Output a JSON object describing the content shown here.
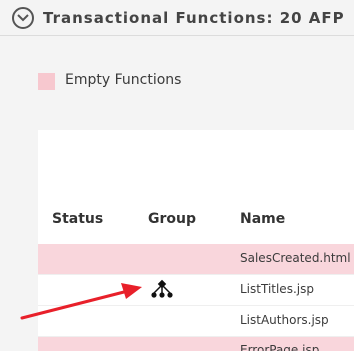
{
  "section": {
    "title": "Transactional Functions: 20 AFP"
  },
  "legend": {
    "label": "Empty Functions",
    "swatch_color": "#f7c8cf"
  },
  "table": {
    "columns": [
      "Status",
      "Group",
      "Name"
    ],
    "rows": [
      {
        "name": "SalesCreated.html",
        "empty": true,
        "group_icon": ""
      },
      {
        "name": "ListTitles.jsp",
        "empty": false,
        "group_icon": "group-hierarchy-icon"
      },
      {
        "name": "ListAuthors.jsp",
        "empty": false,
        "group_icon": ""
      },
      {
        "name": "ErrorPage.jsp",
        "empty": true,
        "group_icon": ""
      }
    ]
  },
  "colors": {
    "empty_row": "#f9d6dc",
    "arrow": "#e8202a"
  }
}
